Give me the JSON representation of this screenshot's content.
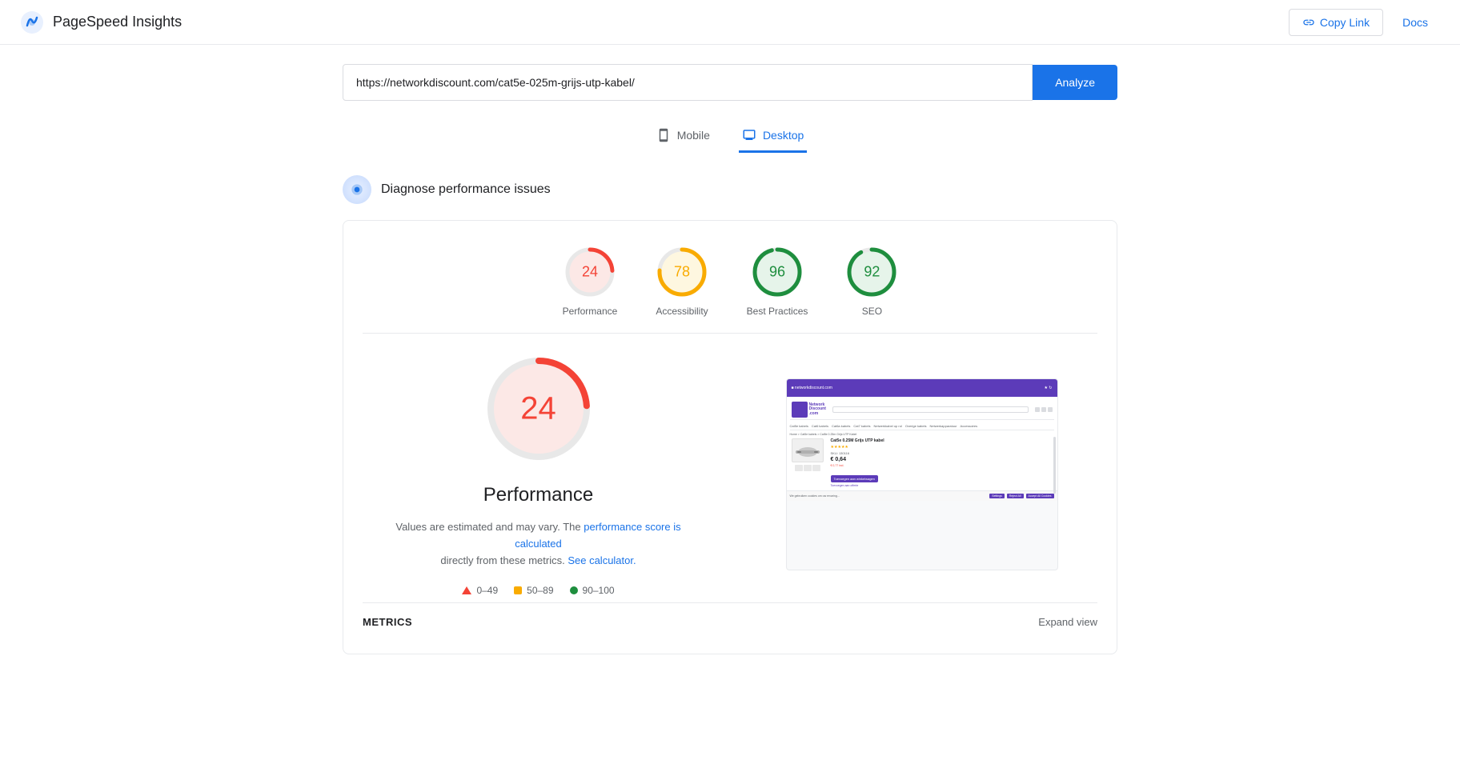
{
  "header": {
    "logo_text": "PageSpeed Insights",
    "copy_link_label": "Copy Link",
    "docs_label": "Docs"
  },
  "url_bar": {
    "url_value": "https://networkdiscount.com/cat5e-025m-grijs-utp-kabel/",
    "analyze_label": "Analyze"
  },
  "tabs": {
    "mobile_label": "Mobile",
    "desktop_label": "Desktop",
    "active": "desktop"
  },
  "diagnose": {
    "text": "Diagnose performance issues"
  },
  "scores": [
    {
      "id": "performance",
      "value": 24,
      "label": "Performance",
      "color": "#f44336",
      "bg": "#fce8e6",
      "pct": 24
    },
    {
      "id": "accessibility",
      "value": 78,
      "label": "Accessibility",
      "color": "#f9ab00",
      "bg": "#fef7e0",
      "pct": 78
    },
    {
      "id": "best-practices",
      "value": 96,
      "label": "Best Practices",
      "color": "#1e8e3e",
      "bg": "#e6f4ea",
      "pct": 96
    },
    {
      "id": "seo",
      "value": 92,
      "label": "SEO",
      "color": "#1e8e3e",
      "bg": "#e6f4ea",
      "pct": 92
    }
  ],
  "detail": {
    "score": 24,
    "title": "Performance",
    "description_text": "Values are estimated and may vary. The",
    "link1_text": "performance score is calculated",
    "description_mid": "directly from these metrics.",
    "link2_text": "See calculator.",
    "color": "#f44336",
    "bg": "#fce8e6"
  },
  "legend": [
    {
      "type": "triangle",
      "range": "0–49",
      "color": "#f44336"
    },
    {
      "type": "square",
      "range": "50–89",
      "color": "#f9ab00"
    },
    {
      "type": "circle",
      "range": "90–100",
      "color": "#1e8e3e"
    }
  ],
  "footer": {
    "metrics_label": "METRICS",
    "expand_label": "Expand view"
  }
}
